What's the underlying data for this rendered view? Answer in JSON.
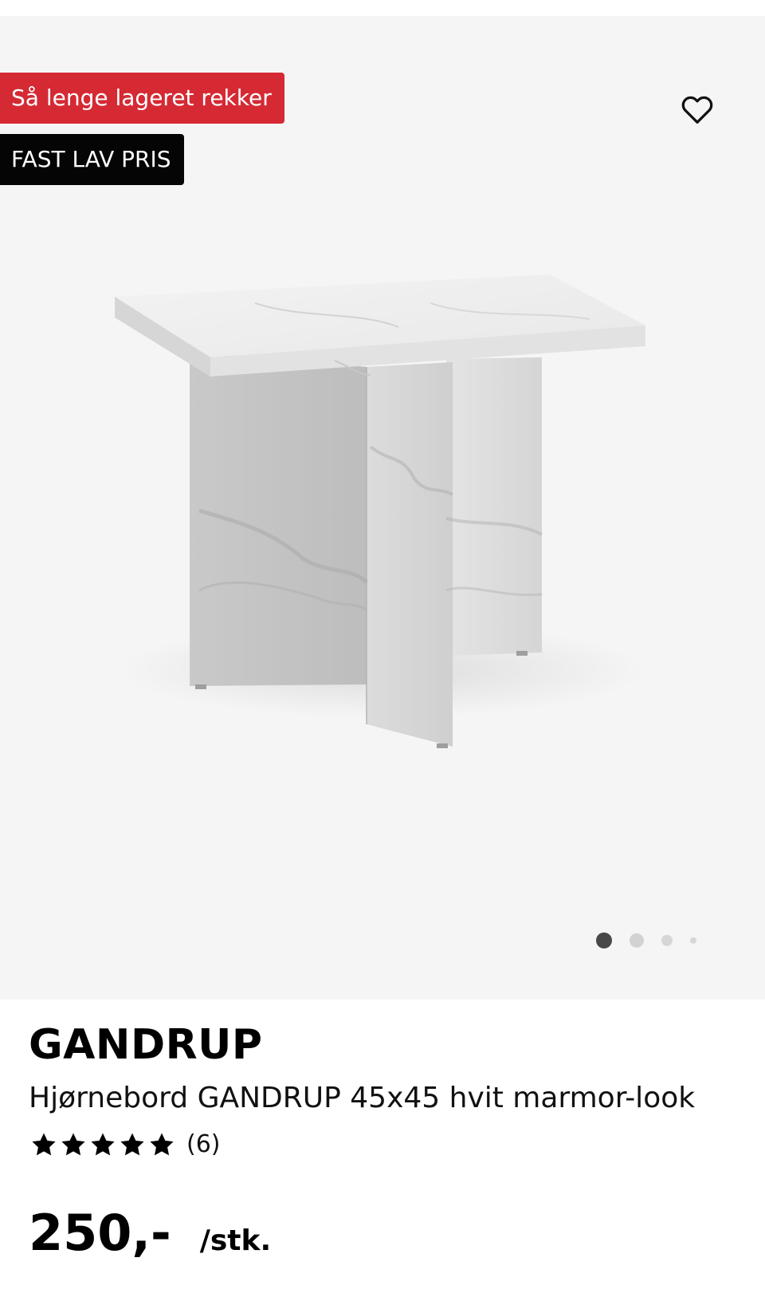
{
  "badges": {
    "stock": "Så lenge lageret rekker",
    "price": "FAST LAV PRIS"
  },
  "colors": {
    "stock_badge": "#d52a34",
    "price_badge": "#050505",
    "gallery_bg": "#f5f5f5"
  },
  "icons": {
    "favorite": "heart-outline-icon",
    "rating": "star-icon"
  },
  "carousel": {
    "image_count": 4,
    "active_index": 0
  },
  "product": {
    "brand": "GANDRUP",
    "description": "Hjørnebord GANDRUP 45x45 hvit marmor-look",
    "rating_stars": 5,
    "review_count": "(6)",
    "price": "250,-",
    "unit": "/stk."
  }
}
